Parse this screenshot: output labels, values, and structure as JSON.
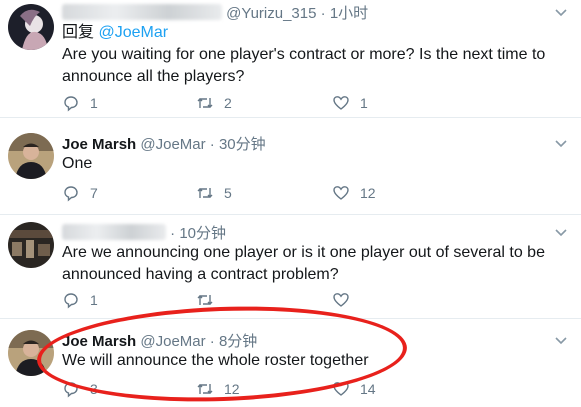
{
  "tweets": [
    {
      "name": "",
      "handle": "@Yurizu_315",
      "time": "1小时",
      "reply_prefix": "回复",
      "reply_to": "@JoeMar",
      "text": "Are you waiting for one player's contract or more? Is the next time to announce all the players?",
      "replies": "1",
      "retweets": "2",
      "likes": "1"
    },
    {
      "name": "Joe Marsh",
      "handle": "@JoeMar",
      "time": "30分钟",
      "text": "One",
      "replies": "7",
      "retweets": "5",
      "likes": "12"
    },
    {
      "name": "",
      "handle": "",
      "time": "10分钟",
      "text": "Are we announcing one player or is it one player out of several to be announced having a contract problem?",
      "replies": "1",
      "retweets": "",
      "likes": ""
    },
    {
      "name": "Joe Marsh",
      "handle": "@JoeMar",
      "time": "8分钟",
      "text": "We will announce the whole roster together",
      "replies": "3",
      "retweets": "12",
      "likes": "14"
    }
  ],
  "separator": "·",
  "icons": {
    "reply": "reply-icon",
    "retweet": "retweet-icon",
    "like": "heart-icon",
    "menu": "chevron-down-icon"
  },
  "colors": {
    "accent": "#1da1f2",
    "muted": "#657786",
    "annotation": "#e8211c"
  }
}
